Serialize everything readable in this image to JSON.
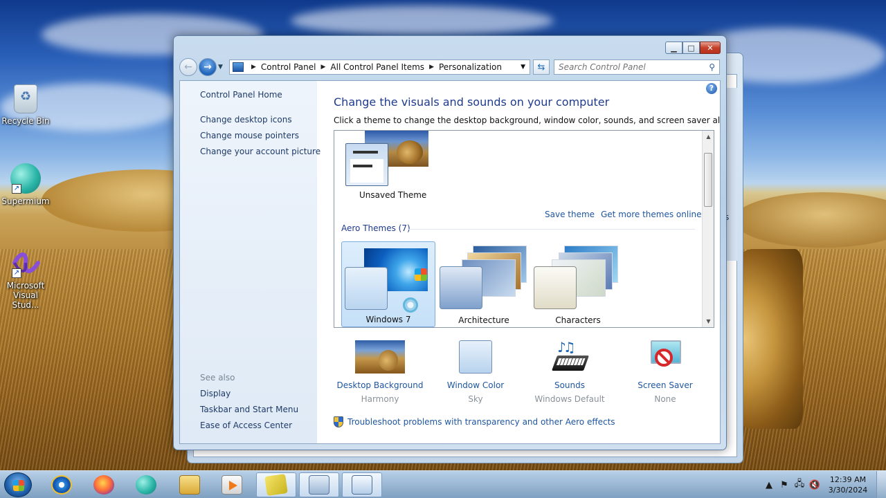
{
  "desktop": {
    "icons": [
      {
        "label": "Recycle Bin",
        "icon": "recycle-bin-icon"
      },
      {
        "label": "Supermium",
        "icon": "supermium-icon"
      },
      {
        "label_line1": "Microsoft",
        "label_line2": "Visual Stud...",
        "icon": "visual-studio-icon"
      }
    ]
  },
  "window": {
    "caption_buttons": {
      "minimize": "▁",
      "maximize": "□",
      "close": "✕"
    },
    "address": {
      "crumbs": [
        "Control Panel",
        "All Control Panel Items",
        "Personalization"
      ]
    },
    "search": {
      "placeholder": "Search Control Panel"
    },
    "left_pane": {
      "home": "Control Panel Home",
      "tasks": [
        "Change desktop icons",
        "Change mouse pointers",
        "Change your account picture"
      ],
      "see_also_label": "See also",
      "see_also": [
        "Display",
        "Taskbar and Start Menu",
        "Ease of Access Center"
      ]
    },
    "main": {
      "help": "?",
      "title": "Change the visuals and sounds on your computer",
      "subtitle": "Click a theme to change the desktop background, window color, sounds, and screen saver all at once.",
      "unsaved_theme": "Unsaved Theme",
      "save_theme": "Save theme",
      "get_more": "Get more themes online",
      "aero_group": "Aero Themes (7)",
      "themes": [
        {
          "name": "Windows 7",
          "selected": true
        },
        {
          "name": "Architecture",
          "selected": false
        },
        {
          "name": "Characters",
          "selected": false
        }
      ],
      "bottom": [
        {
          "name": "Desktop Background",
          "value": "Harmony"
        },
        {
          "name": "Window Color",
          "value": "Sky"
        },
        {
          "name": "Sounds",
          "value": "Windows Default"
        },
        {
          "name": "Screen Saver",
          "value": "None"
        }
      ],
      "troubleshoot": "Troubleshoot problems with transparency and other Aero effects"
    }
  },
  "background_window": {
    "partial_text": "s"
  },
  "taskbar": {
    "clock": {
      "time": "12:39 AM",
      "date": "3/30/2024"
    },
    "tray_expand": "▲"
  },
  "colors": {
    "link": "#1e56a0",
    "title": "#1e3a8c",
    "selection": "#c5e0f8",
    "close_button": "#c4402a"
  }
}
